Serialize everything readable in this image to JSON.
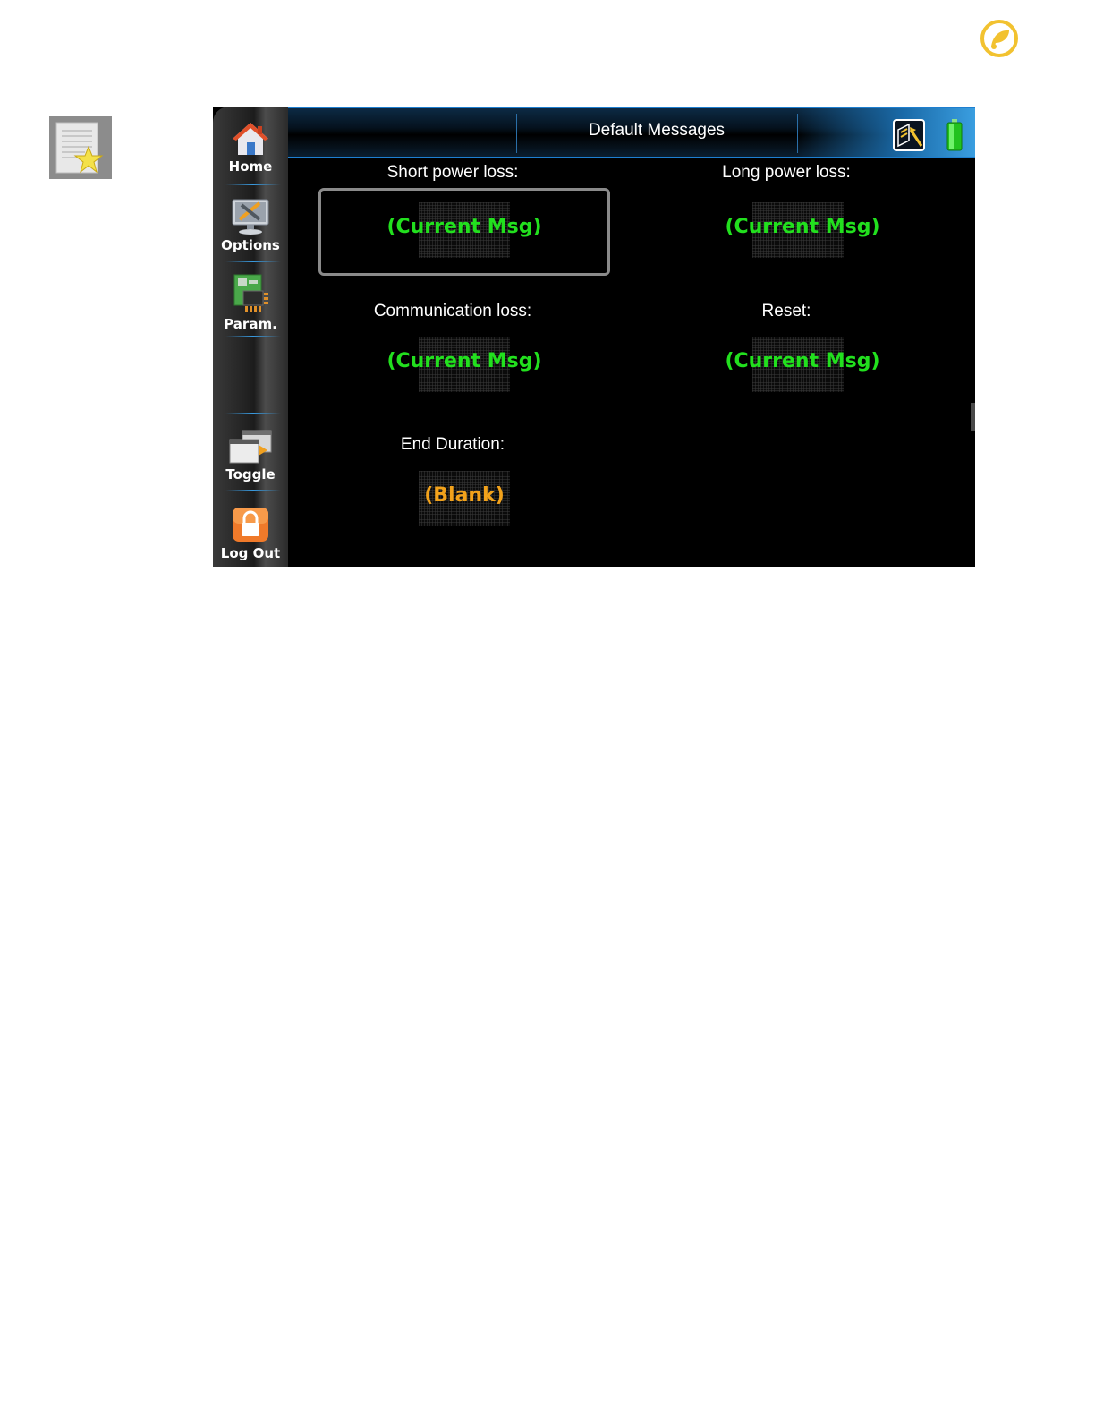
{
  "header": {
    "title": "Default Messages"
  },
  "sidebar": {
    "items": [
      {
        "label": "Home"
      },
      {
        "label": "Options"
      },
      {
        "label": "Param."
      },
      {
        "label": "Toggle"
      },
      {
        "label": "Log Out"
      }
    ]
  },
  "fields": {
    "short_power_loss": {
      "label": "Short power loss:",
      "value": "(Current Msg)"
    },
    "long_power_loss": {
      "label": "Long power loss:",
      "value": "(Current Msg)"
    },
    "communication_loss": {
      "label": "Communication loss:",
      "value": "(Current Msg)"
    },
    "reset": {
      "label": "Reset:",
      "value": "(Current Msg)"
    },
    "end_duration": {
      "label": "End Duration:",
      "value": "(Blank)"
    }
  },
  "colors": {
    "current_msg": "#22e01e",
    "blank": "#f2a21b",
    "header_accent": "#1e7fd0",
    "brand": "#f2c230"
  },
  "icons": [
    "brand-logo-icon",
    "document-star-icon",
    "home-icon",
    "options-tools-icon",
    "parameters-chip-icon",
    "toggle-windows-icon",
    "lock-icon",
    "network-icon",
    "battery-icon"
  ]
}
